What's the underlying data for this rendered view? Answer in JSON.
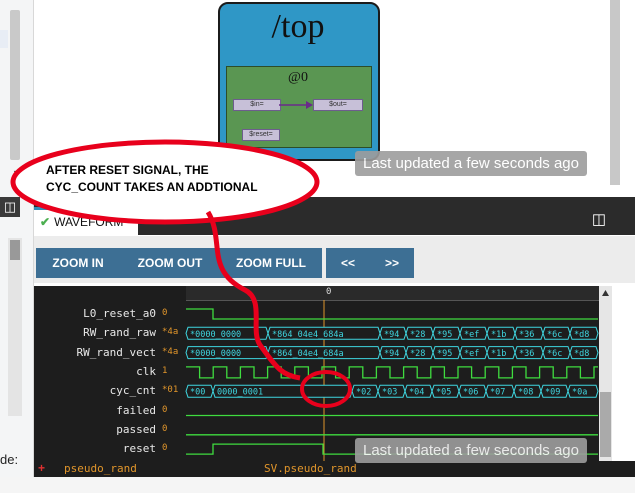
{
  "left_panel": {
    "lower_text": "de:"
  },
  "diagram": {
    "module_title": "/top",
    "cycle_label": "@0",
    "signals": {
      "in": "$in=",
      "out": "$out=",
      "reset": "$reset="
    }
  },
  "annotation": {
    "line1": "AFTER RESET SIGNAL, THE",
    "line2": "CYC_COUNT TAKES AN ADDTIONAL"
  },
  "toasts": {
    "top": "Last updated a few seconds ago",
    "bottom": "Last updated a few seconds ago"
  },
  "tabs": {
    "waveform": "WAVEFORM"
  },
  "toolbar": {
    "zoom_in": "ZOOM IN",
    "zoom_out": "ZOOM OUT",
    "zoom_full": "ZOOM FULL",
    "prev": "<<",
    "next": ">>"
  },
  "ruler": {
    "zero_label": "0"
  },
  "waveform": {
    "signals": [
      {
        "name": "L0_reset_a0",
        "value": "0"
      },
      {
        "name": "RW_rand_raw",
        "value": "*4a"
      },
      {
        "name": "RW_rand_vect",
        "value": "*4a"
      },
      {
        "name": "clk",
        "value": "1"
      },
      {
        "name": "cyc_cnt",
        "value": "*01"
      },
      {
        "name": "failed",
        "value": "0"
      },
      {
        "name": "passed",
        "value": "0"
      },
      {
        "name": "reset",
        "value": "0"
      }
    ],
    "bus_labels": {
      "rand_raw": [
        "*0000_0000",
        "*864_04e4_684a",
        "*94",
        "*28",
        "*95",
        "*ef",
        "*1b",
        "*36",
        "*6c",
        "*d8"
      ],
      "rand_vect": [
        "*0000_0000",
        "*864_04e4_684a",
        "*94",
        "*28",
        "*95",
        "*ef",
        "*1b",
        "*36",
        "*6c",
        "*d8"
      ],
      "cyc_cnt": [
        "*00",
        "0000_0001",
        "*02",
        "*03",
        "*04",
        "*05",
        "*06",
        "*07",
        "*08",
        "*09",
        "*0a"
      ]
    }
  },
  "footer": {
    "scope": "pseudo_rand",
    "instance": "SV.pseudo_rand"
  },
  "colors": {
    "wave_green": "#3fdc3f",
    "bus_cyan": "#3fd6e0",
    "value_orange": "#e0952b",
    "marker_line": "#e0952b",
    "annotation_red": "#e8001c",
    "button_blue": "#3d6f94",
    "diagram_blue": "#2f97c6",
    "diagram_green": "#5a9652"
  },
  "icons": {
    "panel_toggle": "panel-toggle-icon",
    "check": "check-icon",
    "expand": "plus-icon"
  }
}
